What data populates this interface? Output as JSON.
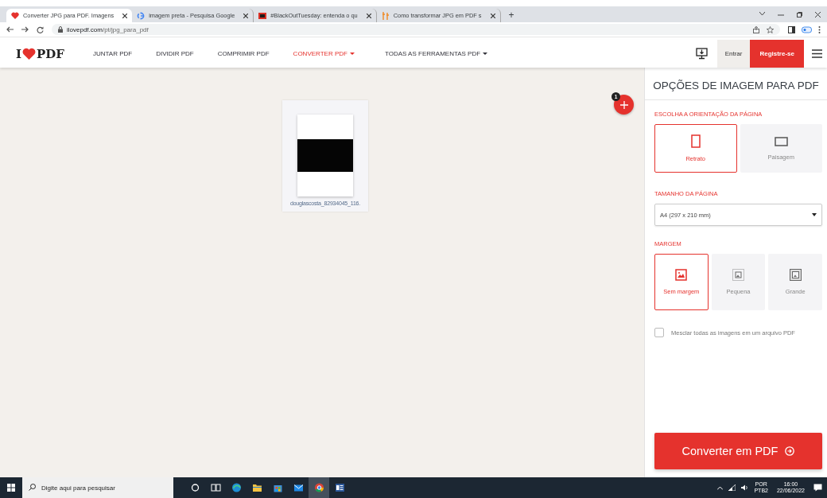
{
  "browser": {
    "tabs": [
      {
        "title": "Converter JPG para PDF. Imagens",
        "kind": "heart",
        "selected": true
      },
      {
        "title": "imagem preta - Pesquisa Google",
        "kind": "google",
        "selected": false
      },
      {
        "title": "#BlackOutTuesday: entenda o qu",
        "kind": "square",
        "selected": false
      },
      {
        "title": "Como transformar JPG em PDF s",
        "kind": "bars",
        "selected": false
      }
    ],
    "new_tab": "+",
    "url": {
      "host": "ilovepdf.com",
      "path": "/pt/jpg_para_pdf"
    }
  },
  "site_nav": {
    "logo": {
      "left": "I",
      "right": "PDF"
    },
    "items": [
      {
        "label": "JUNTAR PDF",
        "selected": false,
        "dropdown": false
      },
      {
        "label": "DIVIDIR PDF",
        "selected": false,
        "dropdown": false
      },
      {
        "label": "COMPRIMIR PDF",
        "selected": false,
        "dropdown": false
      },
      {
        "label": "CONVERTER PDF",
        "selected": true,
        "dropdown": true
      },
      {
        "label": "TODAS AS FERRAMENTAS PDF",
        "selected": false,
        "dropdown": true
      }
    ],
    "login": "Entrar",
    "signup": "Registre-se"
  },
  "workspace": {
    "files": [
      {
        "name": "douglascosta_82934045_116."
      }
    ],
    "file_count": "1"
  },
  "panel": {
    "title": "OPÇÕES DE IMAGEM PARA PDF",
    "orientation": {
      "label": "ESCOLHA A ORIENTAÇÃO DA PÁGINA",
      "options": [
        {
          "label": "Retrato",
          "kind": "portrait",
          "selected": true
        },
        {
          "label": "Paisagem",
          "kind": "landscape",
          "selected": false
        }
      ]
    },
    "page_size": {
      "label": "TAMANHO DA PÁGINA",
      "value": "A4 (297 x 210 mm)"
    },
    "margin": {
      "label": "MARGEM",
      "options": [
        {
          "label": "Sem margem",
          "kind": "none",
          "selected": true
        },
        {
          "label": "Pequena",
          "kind": "small",
          "selected": false
        },
        {
          "label": "Grande",
          "kind": "large",
          "selected": false
        }
      ]
    },
    "merge": {
      "label": "Mesclar todas as imagens em um arquivo PDF",
      "checked": false
    },
    "convert_button": "Converter em PDF"
  },
  "taskbar": {
    "search": {
      "placeholder": "Digite aqui para pesquisar"
    },
    "language": "POR",
    "layout": "PTB2",
    "time": "16:00",
    "date": "22/06/2022"
  }
}
